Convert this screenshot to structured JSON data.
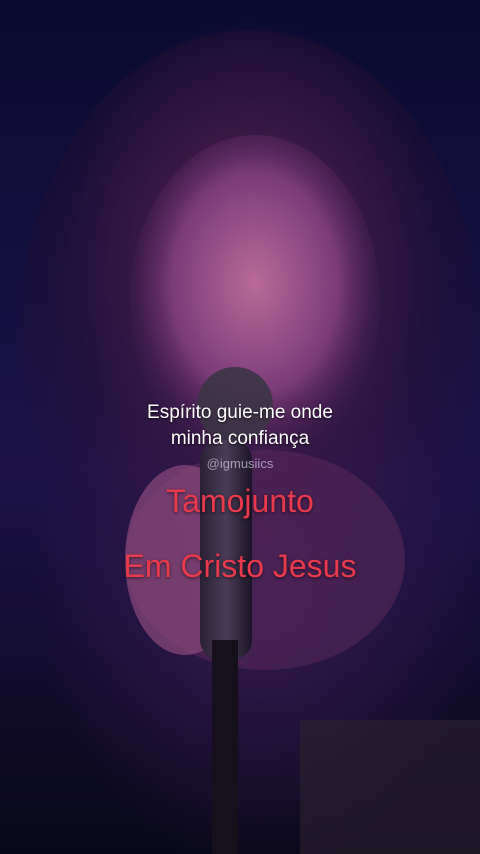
{
  "video": {
    "lyric_lines": [
      "Espírito guie-me onde",
      "minha confiança"
    ],
    "watermark_handle": "@igmusiics",
    "title_line_1": "Tamojunto",
    "title_line_2": "Em Cristo Jesus"
  },
  "colors": {
    "background": "#14103f",
    "lyric_text": "#ffffff",
    "title_text": "#e83a4c",
    "handle_text": "#c8c2d8"
  }
}
